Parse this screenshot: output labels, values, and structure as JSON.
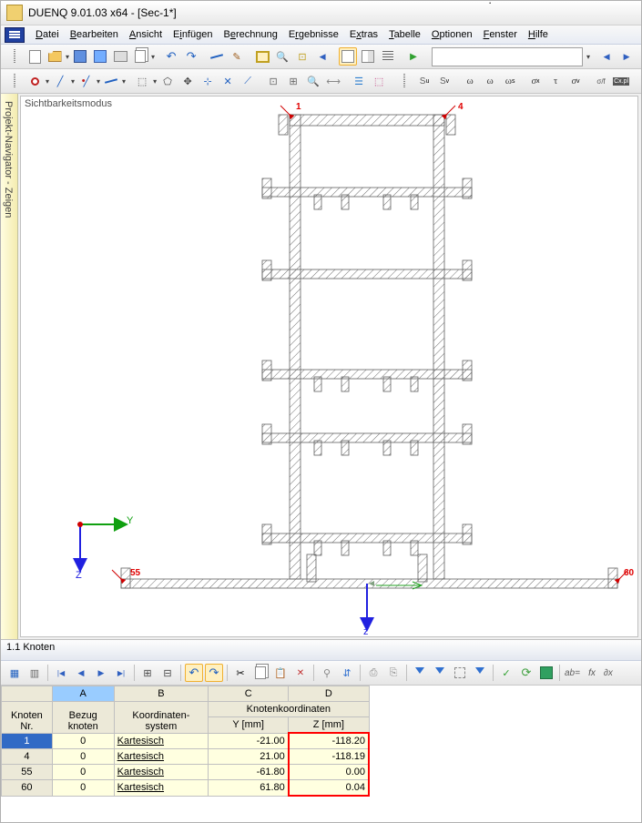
{
  "app": {
    "title": "DUENQ 9.01.03 x64 - [Sec-1*]"
  },
  "menu": {
    "items": [
      "Datei",
      "Bearbeiten",
      "Ansicht",
      "Einfügen",
      "Berechnung",
      "Ergebnisse",
      "Extras",
      "Tabelle",
      "Optionen",
      "Fenster",
      "Hilfe"
    ]
  },
  "sidebar": {
    "tab_label": "Projekt-Navigator - Zeigen"
  },
  "viewport": {
    "mode_label": "Sichtbarkeitsmodus",
    "nodes": {
      "n1": "1",
      "n4": "4",
      "n55": "55",
      "n60": "60"
    },
    "axes": {
      "y": "Y",
      "zleft": "Z",
      "zbottom": "z"
    }
  },
  "panel": {
    "title": "1.1 Knoten",
    "columns": {
      "letters": [
        "A",
        "B",
        "C",
        "D"
      ],
      "h1": [
        "Knoten",
        "Bezug",
        "Koordinaten-",
        "Knotenkoordinaten"
      ],
      "h2": [
        "Nr.",
        "knoten",
        "system",
        "Y [mm]",
        "Z [mm]"
      ]
    },
    "rows": [
      {
        "nr": "1",
        "bezug": "0",
        "sys": "Kartesisch",
        "y": "-21.00",
        "z": "-118.20"
      },
      {
        "nr": "4",
        "bezug": "0",
        "sys": "Kartesisch",
        "y": "21.00",
        "z": "-118.19"
      },
      {
        "nr": "55",
        "bezug": "0",
        "sys": "Kartesisch",
        "y": "-61.80",
        "z": "0.00"
      },
      {
        "nr": "60",
        "bezug": "0",
        "sys": "Kartesisch",
        "y": "61.80",
        "z": "0.04"
      }
    ],
    "fx_label": "ab=",
    "fx2": "fx",
    "fx3": "∂x"
  }
}
